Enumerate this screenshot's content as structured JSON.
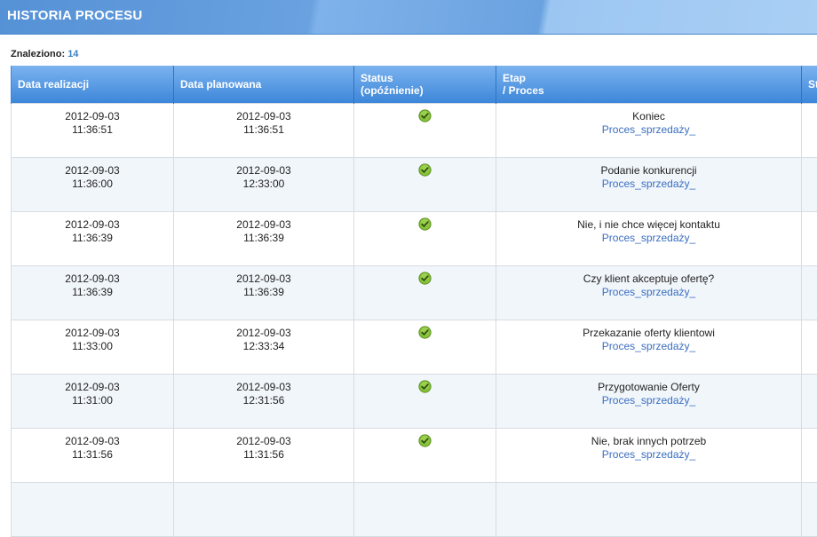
{
  "header": {
    "title": "HISTORIA PROCESU"
  },
  "summary": {
    "label": "Znaleziono",
    "count": "14"
  },
  "columns": {
    "date_done": "Data realizacji",
    "date_planned": "Data planowana",
    "status_line1": "Status",
    "status_line2": "(opóźnienie)",
    "stage_line1": "Etap",
    "stage_line2": "/ Proces",
    "extra": "St"
  },
  "status_icon": "check-circle-icon",
  "colors": {
    "header_bg": "#3d86d9",
    "link": "#3a6ebf",
    "ok": "#7ab51d"
  },
  "rows": [
    {
      "done_date": "2012-09-03",
      "done_time": "11:36:51",
      "plan_date": "2012-09-03",
      "plan_time": "11:36:51",
      "stage": "Koniec",
      "process": "Proces_sprzedaży_"
    },
    {
      "done_date": "2012-09-03",
      "done_time": "11:36:00",
      "plan_date": "2012-09-03",
      "plan_time": "12:33:00",
      "stage": "Podanie konkurencji",
      "process": "Proces_sprzedaży_"
    },
    {
      "done_date": "2012-09-03",
      "done_time": "11:36:39",
      "plan_date": "2012-09-03",
      "plan_time": "11:36:39",
      "stage": "Nie, i nie chce więcej kontaktu",
      "process": "Proces_sprzedaży_"
    },
    {
      "done_date": "2012-09-03",
      "done_time": "11:36:39",
      "plan_date": "2012-09-03",
      "plan_time": "11:36:39",
      "stage": "Czy klient akceptuje ofertę?",
      "process": "Proces_sprzedaży_"
    },
    {
      "done_date": "2012-09-03",
      "done_time": "11:33:00",
      "plan_date": "2012-09-03",
      "plan_time": "12:33:34",
      "stage": "Przekazanie oferty klientowi",
      "process": "Proces_sprzedaży_"
    },
    {
      "done_date": "2012-09-03",
      "done_time": "11:31:00",
      "plan_date": "2012-09-03",
      "plan_time": "12:31:56",
      "stage": "Przygotowanie Oferty",
      "process": "Proces_sprzedaży_"
    },
    {
      "done_date": "2012-09-03",
      "done_time": "11:31:56",
      "plan_date": "2012-09-03",
      "plan_time": "11:31:56",
      "stage": "Nie, brak innych potrzeb",
      "process": "Proces_sprzedaży_"
    },
    {
      "done_date": "",
      "done_time": "",
      "plan_date": "",
      "plan_time": "",
      "stage": "",
      "process": ""
    }
  ]
}
